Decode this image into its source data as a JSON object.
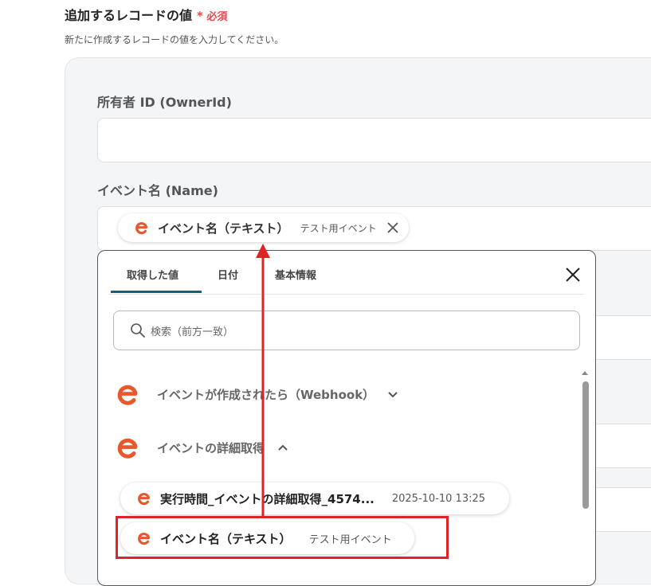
{
  "section": {
    "title": "追加するレコードの値",
    "required_star": "*",
    "required_label": "必須",
    "subtitle": "新たに作成するレコードの値を入力してください。"
  },
  "fields": {
    "owner_id_label": "所有者 ID (OwnerId)",
    "owner_id_value": "",
    "event_name_label": "イベント名 (Name)",
    "event_name_chip": {
      "label": "イベント名（テキスト）",
      "value": "テスト用イベント"
    }
  },
  "dropdown": {
    "tabs": [
      "取得した値",
      "日付",
      "基本情報"
    ],
    "active_tab": "取得した値",
    "search_placeholder": "検索（前方一致）",
    "groups": [
      {
        "label": "イベントが作成されたら（Webhook）",
        "expanded": false
      },
      {
        "label": "イベントの詳細取得",
        "expanded": true
      }
    ],
    "items": [
      {
        "label": "実行時間_イベントの詳細取得_4574...",
        "value": "2025-10-10 13:25"
      },
      {
        "label": "イベント名（テキスト）",
        "value": "テスト用イベント"
      }
    ]
  },
  "colors": {
    "brand": "#e8582c",
    "required": "#e5484d",
    "tab_active": "#1e5c78",
    "annotation": "#e02424"
  },
  "icons": {
    "app_logo": "eventbrite-e-icon",
    "remove": "close-icon",
    "close_dropdown": "close-icon",
    "search": "search-icon",
    "collapsed": "chevron-down-icon",
    "expanded": "chevron-up-icon"
  }
}
